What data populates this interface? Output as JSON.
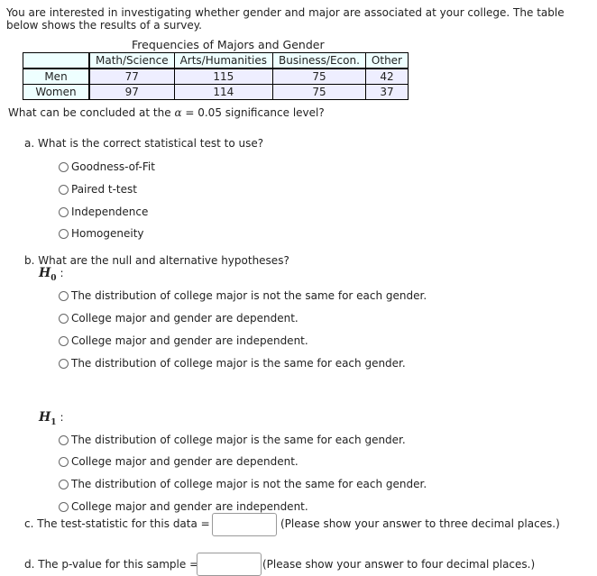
{
  "intro": "You are interested in investigating whether gender and major are associated at your college. The table below shows the results of a survey.",
  "table": {
    "caption": "Frequencies of Majors and Gender",
    "columns": [
      "",
      "Math/Science",
      "Arts/Humanities",
      "Business/Econ.",
      "Other"
    ],
    "rows": [
      {
        "label": "Men",
        "values": [
          "77",
          "115",
          "75",
          "42"
        ]
      },
      {
        "label": "Women",
        "values": [
          "97",
          "114",
          "75",
          "37"
        ]
      }
    ]
  },
  "conclusion_prompt": {
    "before": "What can be concluded at the ",
    "alpha_symbol": "α",
    "after": " = 0.05 significance level?"
  },
  "part_a": {
    "question": "a. What is the correct statistical test to use?",
    "options": [
      "Goodness-of-Fit",
      "Paired t-test",
      "Independence",
      "Homogeneity"
    ]
  },
  "part_b": {
    "question": "b. What are the null and alternative hypotheses?",
    "h0": {
      "symbol": "H",
      "sub": "0",
      "colon": ":",
      "options": [
        "The distribution of college major is not the same for each gender.",
        "College major and gender are dependent.",
        "College major and gender are independent.",
        "The distribution of college major is the same for each gender."
      ]
    },
    "h1": {
      "symbol": "H",
      "sub": "1",
      "colon": ":",
      "options": [
        "The distribution of college major is the same for each gender.",
        "College major and gender are dependent.",
        "The distribution of college major is not the same for each gender.",
        "College major and gender are independent."
      ]
    }
  },
  "part_c": {
    "label": "c. The test-statistic for this data =",
    "value": "",
    "hint": "(Please show your answer to three decimal places.)"
  },
  "part_d": {
    "label": "d. The p-value for this sample =",
    "value": "",
    "hint": "(Please show your answer to four decimal places.)"
  }
}
